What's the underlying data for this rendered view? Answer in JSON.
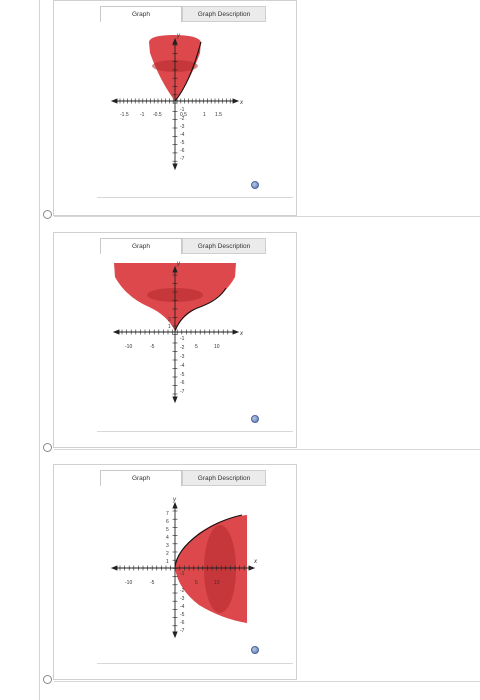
{
  "options": [
    {
      "tabs": {
        "graph": "Graph",
        "description": "Graph Description"
      },
      "axes": {
        "x_label": "x",
        "y_label": "y"
      },
      "x_ticks": [
        "-1.5",
        "-1",
        "-0.5",
        "0.5",
        "1",
        "1.5"
      ],
      "y_ticks": [
        "7",
        "6",
        "5",
        "4",
        "3",
        "2",
        "1",
        "-1",
        "-2",
        "-3",
        "-4",
        "-5",
        "-6",
        "-7"
      ],
      "x_range": [
        -1.8,
        1.8
      ],
      "y_range": [
        -7.5,
        7.5
      ],
      "solid_color": "#d43a3a"
    },
    {
      "tabs": {
        "graph": "Graph",
        "description": "Graph Description"
      },
      "axes": {
        "x_label": "x",
        "y_label": "y"
      },
      "x_ticks": [
        "-10",
        "-5",
        "5",
        "10"
      ],
      "y_ticks": [
        "7",
        "6",
        "5",
        "4",
        "3",
        "2",
        "1",
        "-1",
        "-2",
        "-3",
        "-4",
        "-5",
        "-6",
        "-7"
      ],
      "x_range": [
        -13,
        13
      ],
      "y_range": [
        -7.5,
        7.5
      ],
      "solid_color": "#d43a3a"
    },
    {
      "tabs": {
        "graph": "Graph",
        "description": "Graph Description"
      },
      "axes": {
        "x_label": "x",
        "y_label": "y"
      },
      "x_ticks": [
        "-10",
        "-5",
        "5",
        "10"
      ],
      "y_ticks": [
        "7",
        "6",
        "5",
        "4",
        "3",
        "2",
        "1",
        "-1",
        "-2",
        "-3",
        "-4",
        "-5",
        "-6",
        "-7"
      ],
      "x_range": [
        -13,
        13
      ],
      "y_range": [
        -7.5,
        7.5
      ],
      "solid_color": "#d43a3a"
    }
  ]
}
